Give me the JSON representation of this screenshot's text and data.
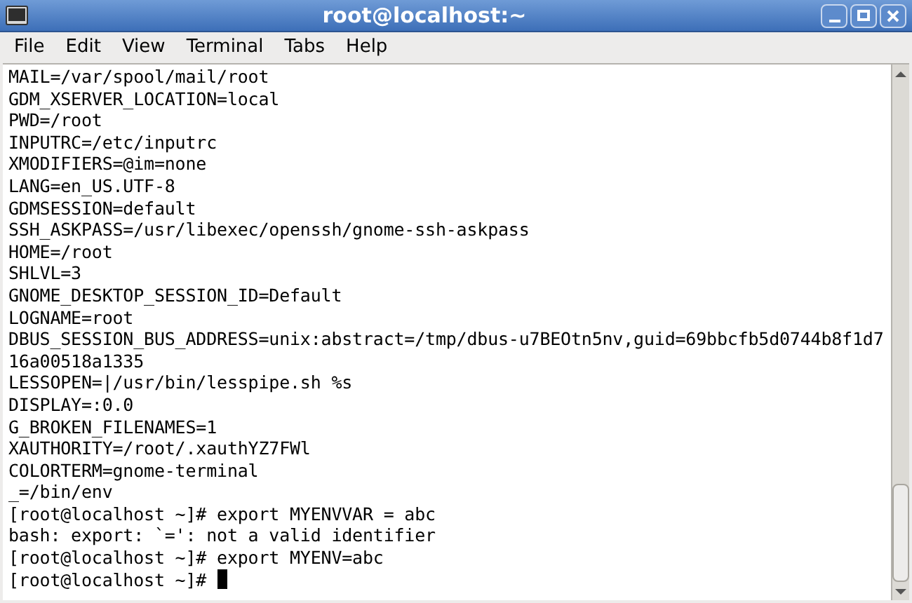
{
  "window": {
    "title": "root@localhost:~"
  },
  "menu": [
    {
      "label": "File"
    },
    {
      "label": "Edit"
    },
    {
      "label": "View"
    },
    {
      "label": "Terminal"
    },
    {
      "label": "Tabs"
    },
    {
      "label": "Help"
    }
  ],
  "terminal": {
    "lines": [
      {
        "text": "MAIL=/var/spool/mail/root",
        "cursor": false
      },
      {
        "text": "GDM_XSERVER_LOCATION=local",
        "cursor": false
      },
      {
        "text": "PWD=/root",
        "cursor": false
      },
      {
        "text": "INPUTRC=/etc/inputrc",
        "cursor": false
      },
      {
        "text": "XMODIFIERS=@im=none",
        "cursor": false
      },
      {
        "text": "LANG=en_US.UTF-8",
        "cursor": false
      },
      {
        "text": "GDMSESSION=default",
        "cursor": false
      },
      {
        "text": "SSH_ASKPASS=/usr/libexec/openssh/gnome-ssh-askpass",
        "cursor": false
      },
      {
        "text": "HOME=/root",
        "cursor": false
      },
      {
        "text": "SHLVL=3",
        "cursor": false
      },
      {
        "text": "GNOME_DESKTOP_SESSION_ID=Default",
        "cursor": false
      },
      {
        "text": "LOGNAME=root",
        "cursor": false
      },
      {
        "text": "DBUS_SESSION_BUS_ADDRESS=unix:abstract=/tmp/dbus-u7BEOtn5nv,guid=69bbcfb5d0744b8f1d7",
        "cursor": false
      },
      {
        "text": "16a00518a1335",
        "cursor": false
      },
      {
        "text": "LESSOPEN=|/usr/bin/lesspipe.sh %s",
        "cursor": false
      },
      {
        "text": "DISPLAY=:0.0",
        "cursor": false
      },
      {
        "text": "G_BROKEN_FILENAMES=1",
        "cursor": false
      },
      {
        "text": "XAUTHORITY=/root/.xauthYZ7FWl",
        "cursor": false
      },
      {
        "text": "COLORTERM=gnome-terminal",
        "cursor": false
      },
      {
        "text": "_=/bin/env",
        "cursor": false
      },
      {
        "text": "[root@localhost ~]# export MYENVVAR = abc",
        "cursor": false
      },
      {
        "text": "bash: export: `=': not a valid identifier",
        "cursor": false
      },
      {
        "text": "[root@localhost ~]# export MYENV=abc",
        "cursor": false
      },
      {
        "text": "[root@localhost ~]# ",
        "cursor": true
      }
    ]
  }
}
